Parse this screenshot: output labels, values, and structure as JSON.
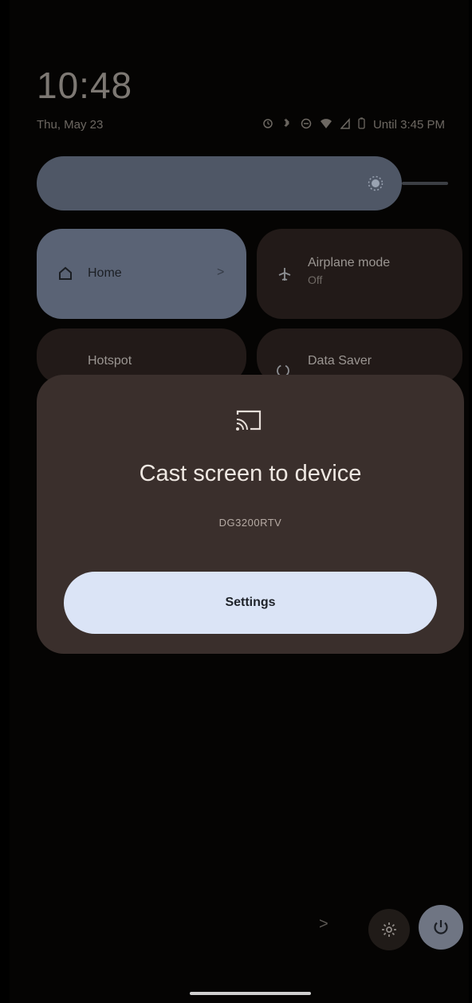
{
  "status_bar": {
    "time": "10:48",
    "date": "Thu, May 23",
    "battery_text": "Until 3:45 PM"
  },
  "quick_settings": {
    "tiles": [
      {
        "label": "Home",
        "sub": "",
        "icon": "home-icon",
        "chevron": ">"
      },
      {
        "label": "Airplane mode",
        "sub": "Off",
        "icon": "airplane-icon"
      },
      {
        "label": "Hotspot",
        "sub": "",
        "icon": "hotspot-icon"
      },
      {
        "label": "Data Saver",
        "sub": "",
        "icon": "data-saver-icon"
      }
    ]
  },
  "dialog": {
    "icon": "cast-icon",
    "title": "Cast screen to device",
    "device": "DG3200RTV",
    "settings_label": "Settings"
  },
  "bottom_bar": {
    "chevron": ">",
    "settings_icon": "gear-icon",
    "power_icon": "power-icon"
  },
  "colors": {
    "dialog_bg": "#3a2f2c",
    "settings_button_bg": "#dbe4f6",
    "home_tile_bg": "#5a6375",
    "brightness_bg": "#4f5766"
  }
}
